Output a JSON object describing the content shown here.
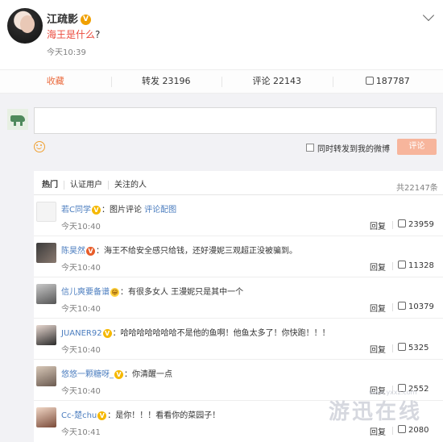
{
  "post": {
    "author": "江疏影",
    "verified_badge": "V",
    "text_highlight": "海王是什么",
    "text_rest": "?",
    "time": "今天10:39"
  },
  "actions": {
    "favorite": "收藏",
    "repost": "转发 23196",
    "comment": "评论 22143",
    "like": "187787"
  },
  "composer": {
    "repost_label": "同时转发到我的微博",
    "submit_label": "评论"
  },
  "filters": {
    "hot": "热门",
    "verified_users": "认证用户",
    "following": "关注的人",
    "total": "共22147条"
  },
  "comments": [
    {
      "user": "若C同学",
      "badge": "V",
      "text_pre": "图片评论 ",
      "text_link": "评论配图",
      "time": "今天10:40",
      "reply": "回复",
      "likes": "23959"
    },
    {
      "user": "陈昊然",
      "badge": "V",
      "text_pre": "海王不给安全感只给钱，还好漫妮三观超正没被骗到。",
      "text_link": "",
      "time": "今天10:40",
      "reply": "回复",
      "likes": "11328"
    },
    {
      "user": "信儿爽要备谱",
      "badge": "😁",
      "text_pre": "有很多女人 王漫妮只是其中一个",
      "text_link": "",
      "time": "今天10:40",
      "reply": "回复",
      "likes": "10379"
    },
    {
      "user": "JUANER92",
      "badge": "V",
      "text_pre": "哈哈哈哈哈哈哈不是他的鱼啊！他鱼太多了！你快跑！！！",
      "text_link": "",
      "time": "今天10:40",
      "reply": "回复",
      "likes": "5325"
    },
    {
      "user": "悠悠一颗糖呀_",
      "badge": "V",
      "text_pre": "你清醒一点",
      "text_link": "",
      "time": "今天10:40",
      "reply": "回复",
      "likes": "2552"
    },
    {
      "user": "Cc-楚chu",
      "badge": "V",
      "text_pre": "是你！！！看看你的菜园子！",
      "text_link": "",
      "time": "今天10:41",
      "reply": "回复",
      "likes": "2080"
    }
  ],
  "watermark": {
    "text": "游迅在线",
    "url": "www.yxxz.com"
  },
  "colors": {
    "accent": "#eb4b3e",
    "username": "#4b7dbf",
    "submit": "#f7b59c",
    "composer_bg": "#f2f2f5"
  }
}
